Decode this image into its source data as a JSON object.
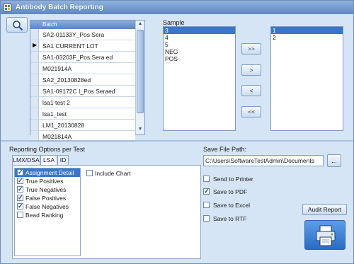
{
  "window": {
    "title": "Antibody Batch Reporting"
  },
  "batch": {
    "header": "Batch",
    "rows": [
      "SA2-01133Y_Pos Sera",
      "SA1 CURRENT LOT",
      "SA1-03203F_Pos Sera ed",
      "M021914A",
      "SA2_20130828ed",
      "SA1-09172C I_Pos Seraed",
      "lsa1 test 2",
      "lsa1_test",
      "LM1_20130828",
      "M021814A"
    ]
  },
  "sample": {
    "label": "Sample",
    "items": [
      "3",
      "4",
      "5",
      "NEG",
      "POS"
    ],
    "selected_index": 0
  },
  "selected_samples": {
    "items": [
      "1",
      "2"
    ],
    "selected_index": 0
  },
  "move_buttons": {
    "all_right": ">>",
    "right": ">",
    "left": "<",
    "all_left": "<<"
  },
  "reporting": {
    "label": "Reporting Options per Test",
    "tabs": [
      "LMX/DSA",
      "LSA",
      "ID"
    ],
    "active_tab": "LSA",
    "options": [
      {
        "label": "Assignment Detail",
        "checked": true,
        "highlighted": true
      },
      {
        "label": "True Positives",
        "checked": true
      },
      {
        "label": "True Negatives",
        "checked": true
      },
      {
        "label": "False Positives",
        "checked": true
      },
      {
        "label": "False Negatives",
        "checked": true
      },
      {
        "label": "Bead Ranking",
        "checked": false
      }
    ],
    "include_chart": {
      "label": "Include Chart",
      "checked": false
    }
  },
  "save": {
    "label": "Save File Path:",
    "path": "C:\\Users\\SoftwareTestAdmin\\Documents",
    "browse": "...",
    "outputs": [
      {
        "label": "Send to Printer",
        "checked": false
      },
      {
        "label": "Save to PDF",
        "checked": true
      },
      {
        "label": "Save to Excel",
        "checked": false
      },
      {
        "label": "Save to RTF",
        "checked": false
      }
    ],
    "audit_button": "Audit Report"
  },
  "colors": {
    "titlebar": "#5f87c2",
    "selection": "#3b76c8",
    "background": "#d6e5f6"
  }
}
